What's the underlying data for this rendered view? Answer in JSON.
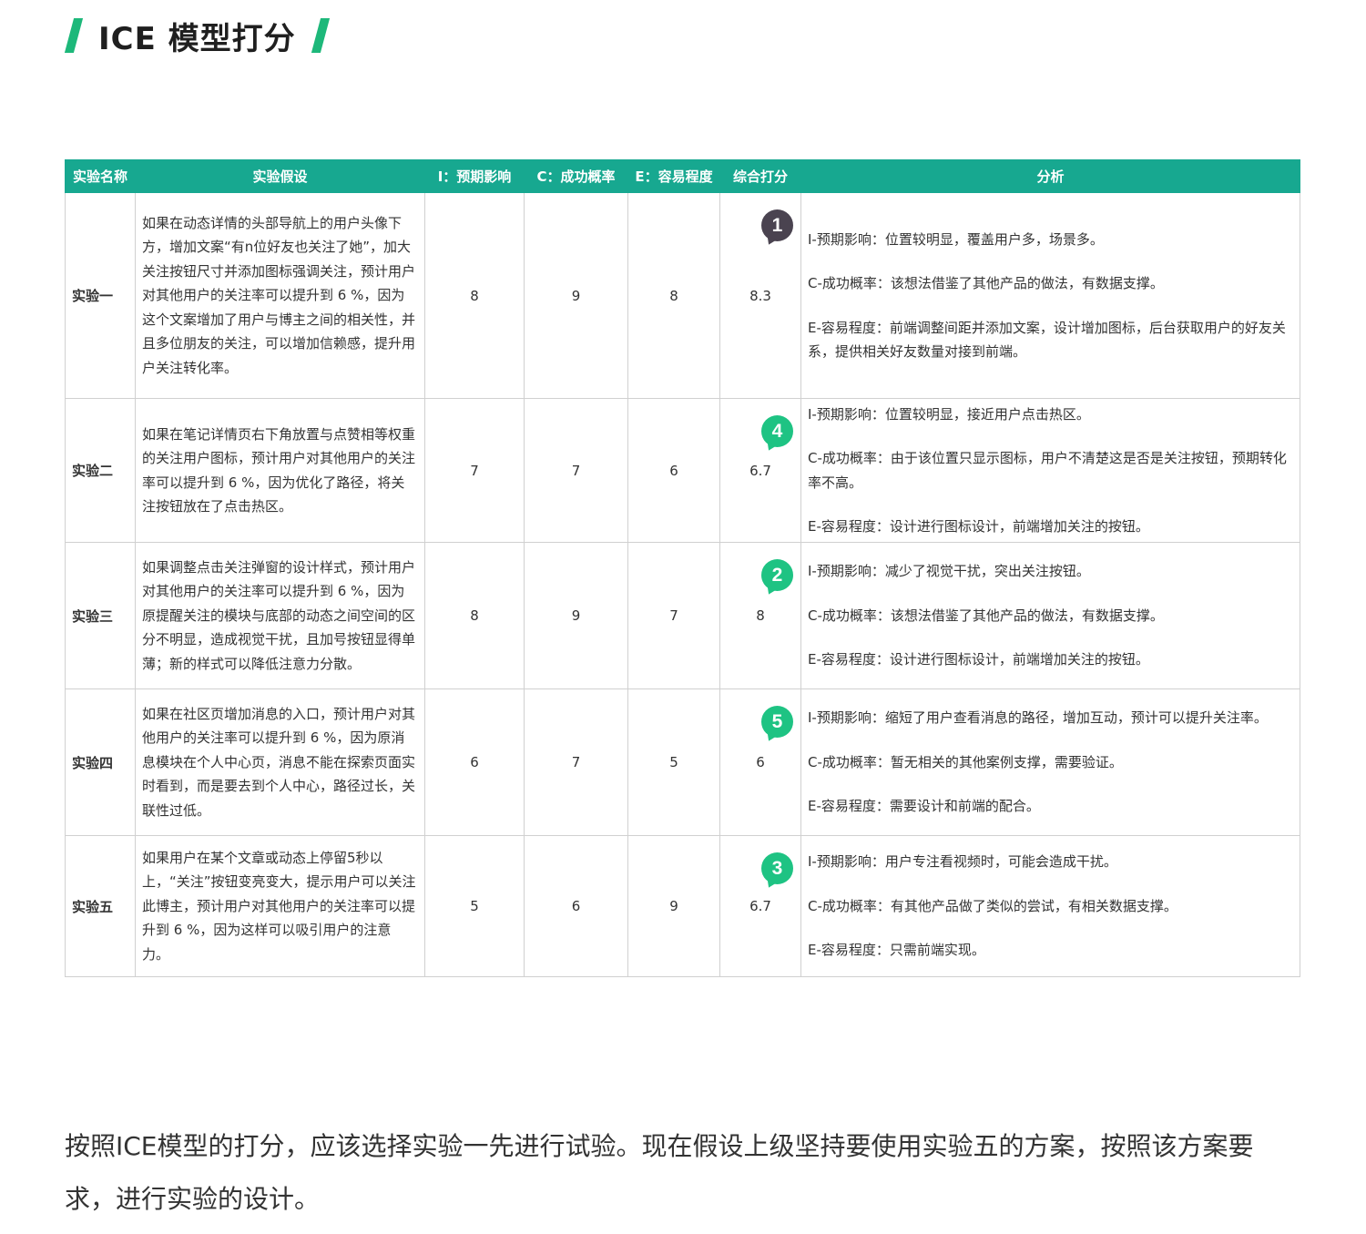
{
  "title": "ICE 模型打分",
  "accent_color": "#1db87a",
  "header_color": "#17a890",
  "table": {
    "headers": [
      "实验名称",
      "实验假设",
      "I：预期影响",
      "C：成功概率",
      "E：容易程度",
      "综合打分",
      "分析"
    ],
    "rows": [
      {
        "name": "实验一",
        "hypothesis": "如果在动态详情的头部导航上的用户头像下方，增加文案“有n位好友也关注了她”，加大关注按钮尺寸并添加图标强调关注，预计用户对其他用户的关注率可以提升到 6 %，因为这个文案增加了用户与博主之间的相关性，并且多位朋友的关注，可以增加信赖感，提升用户关注转化率。",
        "impact": "8",
        "confidence": "9",
        "ease": "8",
        "score": "8.3",
        "rank": "1",
        "rank_color": "#4a4350",
        "analysis": [
          "I-预期影响：位置较明显，覆盖用户多，场景多。",
          "C-成功概率：该想法借鉴了其他产品的做法，有数据支撑。",
          "E-容易程度：前端调整间距并添加文案，设计增加图标，后台获取用户的好友关系，提供相关好友数量对接到前端。"
        ]
      },
      {
        "name": "实验二",
        "hypothesis": "如果在笔记详情页右下角放置与点赞相等权重的关注用户图标，预计用户对其他用户的关注率可以提升到 6 %，因为优化了路径，将关注按钮放在了点击热区。",
        "impact": "7",
        "confidence": "7",
        "ease": "6",
        "score": "6.7",
        "rank": "4",
        "rank_color": "#1ec383",
        "analysis": [
          "I-预期影响：位置较明显，接近用户点击热区。",
          "C-成功概率：由于该位置只显示图标，用户不清楚这是否是关注按钮，预期转化率不高。",
          "E-容易程度：设计进行图标设计，前端增加关注的按钮。"
        ]
      },
      {
        "name": "实验三",
        "hypothesis": "如果调整点击关注弹窗的设计样式，预计用户对其他用户的关注率可以提升到 6 %，因为原提醒关注的模块与底部的动态之间空间的区分不明显，造成视觉干扰，且加号按钮显得单薄；新的样式可以降低注意力分散。",
        "impact": "8",
        "confidence": "9",
        "ease": "7",
        "score": "8",
        "rank": "2",
        "rank_color": "#1ec383",
        "analysis": [
          "I-预期影响：减少了视觉干扰，突出关注按钮。",
          "C-成功概率：该想法借鉴了其他产品的做法，有数据支撑。",
          "E-容易程度：设计进行图标设计，前端增加关注的按钮。"
        ]
      },
      {
        "name": "实验四",
        "hypothesis": "如果在社区页增加消息的入口，预计用户对其他用户的关注率可以提升到 6 %，因为原消息模块在个人中心页，消息不能在探索页面实时看到，而是要去到个人中心，路径过长，关联性过低。",
        "impact": "6",
        "confidence": "7",
        "ease": "5",
        "score": "6",
        "rank": "5",
        "rank_color": "#1ec383",
        "analysis": [
          "I-预期影响：缩短了用户查看消息的路径，增加互动，预计可以提升关注率。",
          "C-成功概率：暂无相关的其他案例支撑，需要验证。",
          "E-容易程度：需要设计和前端的配合。"
        ]
      },
      {
        "name": "实验五",
        "hypothesis": "如果用户在某个文章或动态上停留5秒以上，“关注”按钮变亮变大，提示用户可以关注此博主，预计用户对其他用户的关注率可以提升到 6 %，因为这样可以吸引用户的注意力。",
        "impact": "5",
        "confidence": "6",
        "ease": "9",
        "score": "6.7",
        "rank": "3",
        "rank_color": "#1ec383",
        "analysis": [
          "I-预期影响：用户专注看视频时，可能会造成干扰。",
          "C-成功概率：有其他产品做了类似的尝试，有相关数据支撑。",
          "E-容易程度：只需前端实现。"
        ]
      }
    ]
  },
  "conclusion": "按照ICE模型的打分，应该选择实验一先进行试验。现在假设上级坚持要使用实验五的方案，按照该方案要求，进行实验的设计。"
}
